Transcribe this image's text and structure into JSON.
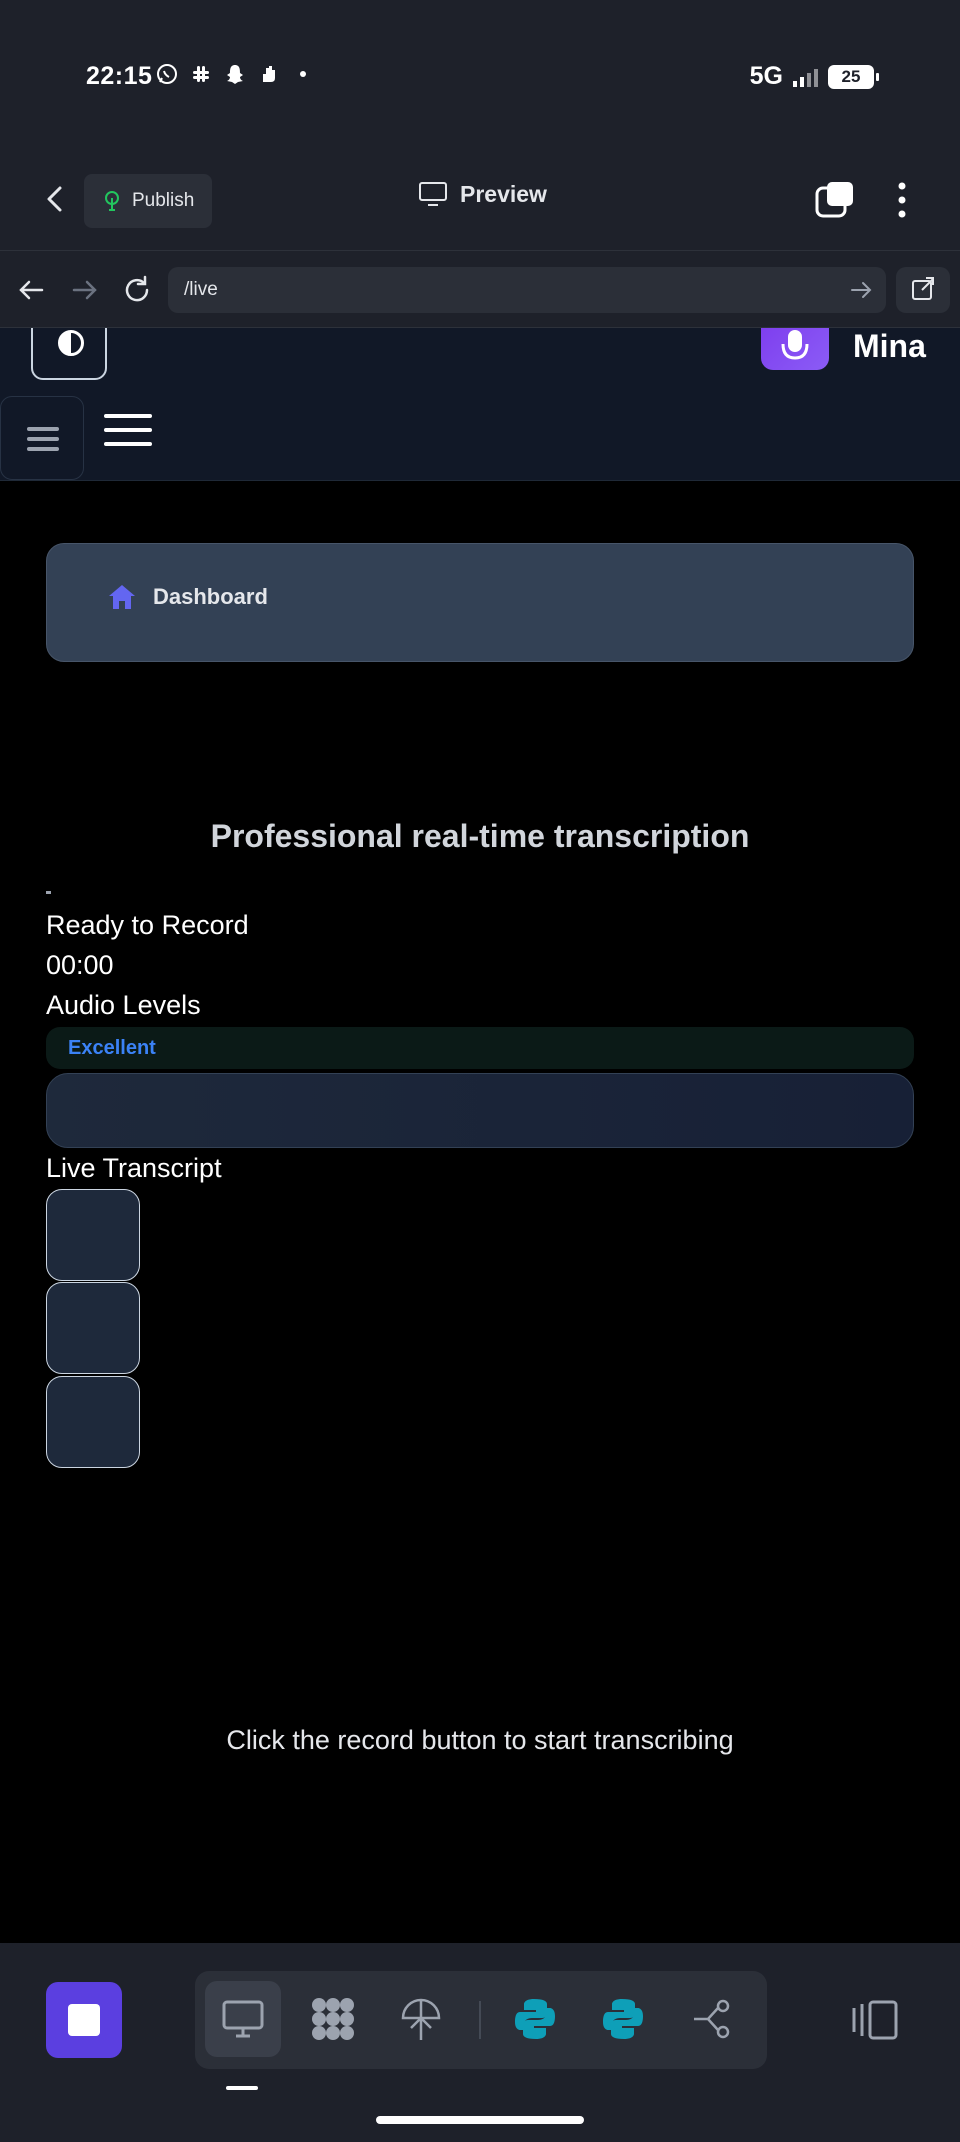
{
  "status_bar": {
    "time": "22:15",
    "network": "5G",
    "battery": "25",
    "notification_icons": [
      "whatsapp-icon",
      "slack-icon",
      "snapchat-icon",
      "hand-icon",
      "dot-icon"
    ]
  },
  "app_header": {
    "publish_label": "Publish",
    "preview_label": "Preview"
  },
  "url_bar": {
    "url": "/live"
  },
  "topnav": {
    "user_name": "Mina"
  },
  "breadcrumb": {
    "home_label": "Dashboard"
  },
  "main": {
    "title": "Professional real-time transcription",
    "status": "Ready to Record",
    "timer": "00:00",
    "audio_levels_title": "Audio Levels",
    "audio_quality": "Excellent",
    "live_transcript_title": "Live Transcript",
    "empty_hint": "Click the record button to start transcribing"
  },
  "dock": {
    "tools": [
      "desktop-icon",
      "grid-blob-icon",
      "satellite-icon",
      "python-icon",
      "python-icon",
      "share-nodes-icon"
    ]
  },
  "colors": {
    "accent": "#5b3fe0",
    "brand_purple": "#8b5cf6",
    "quality_text": "#3b82f6",
    "breadcrumb_icon": "#6366f1",
    "python_teal": "#0e9fb8"
  }
}
